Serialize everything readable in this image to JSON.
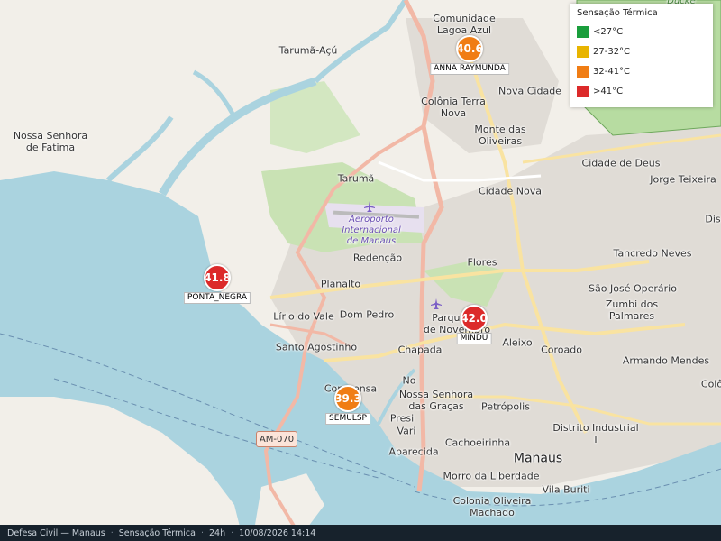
{
  "footer": {
    "org": "Defesa Civil — Manaus",
    "layer": "Sensação Térmica",
    "period": "24h",
    "timestamp": "10/08/2026 14:14"
  },
  "legend": {
    "title": "Sensação Térmica",
    "items": [
      {
        "label": "<27°C",
        "color": "#1a9e3c"
      },
      {
        "label": "27-32°C",
        "color": "#e8b400"
      },
      {
        "label": "32-41°C",
        "color": "#f07d14"
      },
      {
        "label": ">41°C",
        "color": "#dc2a2a"
      }
    ]
  },
  "stations": [
    {
      "name": "ANNA RAYMUNDA",
      "value": "40.6",
      "color": "#f07d14"
    },
    {
      "name": "PONTA_NEGRA",
      "value": "41.8",
      "color": "#dc2a2a"
    },
    {
      "name": "MINDU",
      "value": "42.0",
      "color": "#dc2a2a"
    },
    {
      "name": "SEMULSP",
      "value": "39.3",
      "color": "#f07d14"
    }
  ],
  "road_shield": "AM-070",
  "places": {
    "comunidade": "Comunidade\nLagoa Azul",
    "taruma_acu": "Tarumã-Açú",
    "nova_senhora": "Nossa Senhora\nde Fatima",
    "nova_cidade": "Nova Cidade",
    "colonia_terra": "Colônia Terra\nNova",
    "monte": "Monte das\nOliveiras",
    "cidade_deus": "Cidade de Deus",
    "jorge": "Jorge Teixeira",
    "taruma": "Tarumã",
    "cidade_nova": "Cidade Nova",
    "aeroporto": "Aeroporto\nInternacional\nde Manaus",
    "tancredo": "Tancredo Neves",
    "redencao": "Redenção",
    "flores": "Flores",
    "planalto": "Planalto",
    "sao_jose": "São José Operário",
    "zumbi": "Zumbi dos\nPalmares",
    "lirio": "Lírio do Vale",
    "dom_pedro": "Dom Pedro",
    "parque": "Parque 10\nde Novembro",
    "aleixo": "Aleixo",
    "santo_agostinho": "Santo Agostinho",
    "chapada": "Chapada",
    "coroado": "Coroado",
    "armando": "Armando Mendes",
    "compensa": "Compensa",
    "no": "No",
    "nossa_graca": "Nossa Senhora\ndas Graças",
    "petropolis": "Petrópolis",
    "presi": "Presi",
    "vari": "Vari",
    "distrito": "Distrito Industrial\nI",
    "aparecida": "Aparecida",
    "cachoeirinha": "Cachoeirinha",
    "manaus": "Manaus",
    "morro": "Morro da Liberdade",
    "vila_buriti": "Vila Buriti",
    "colonia_oliveira": "Colonia Oliveira\nMachado",
    "dis": "Dis",
    "colo": "Colô",
    "ducke": "Ducke"
  }
}
